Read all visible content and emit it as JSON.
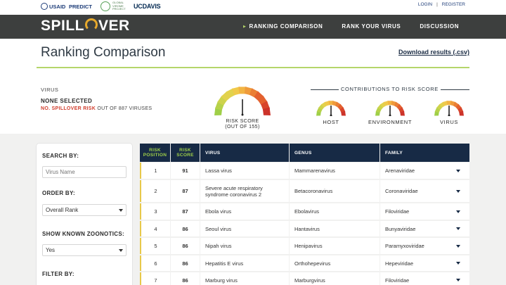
{
  "partners": {
    "usaid": "USAID",
    "predict": "PREDICT",
    "gvp": "GLOBAL VIROME PROJECT",
    "ucdavis": "UCDAVIS"
  },
  "auth": {
    "login": "LOGIN",
    "separator": "|",
    "register": "REGISTER"
  },
  "brand": {
    "name_prefix": "SPILL",
    "name_suffix": "VER"
  },
  "nav": {
    "items": [
      {
        "label": "RANKING COMPARISON",
        "active": true
      },
      {
        "label": "RANK YOUR VIRUS",
        "active": false
      },
      {
        "label": "DISCUSSION",
        "active": false
      }
    ]
  },
  "page": {
    "title": "Ranking Comparison",
    "download_label": "Download results (.csv)"
  },
  "virus_info": {
    "label": "VIRUS",
    "selected": "NONE SELECTED",
    "risk_highlight": "NO. SPILLOVER RISK",
    "risk_rest": "OUT OF 887 VIRUSES"
  },
  "risk_gauge": {
    "label_line1": "RISK SCORE",
    "label_line2": "(OUT OF 155)"
  },
  "contributions": {
    "title": "CONTRIBUTIONS TO RISK SCORE",
    "gauges": [
      {
        "label": "HOST"
      },
      {
        "label": "ENVIRONMENT"
      },
      {
        "label": "VIRUS"
      }
    ]
  },
  "colors": {
    "accent_green": "#b5d66a",
    "nav_bg": "#3d3f3e",
    "table_header": "#172a45",
    "risk_red": "#d13f2f"
  },
  "sidebar": {
    "search_heading": "SEARCH BY:",
    "search_placeholder": "Virus Name",
    "order_heading": "ORDER BY:",
    "order_value": "Overall Rank",
    "zoonotic_heading": "SHOW KNOWN ZOONOTICS:",
    "zoonotic_value": "Yes",
    "filter_heading": "FILTER BY:"
  },
  "table": {
    "headers": {
      "position": "RISK POSITION",
      "score": "RISK SCORE",
      "virus": "VIRUS",
      "genus": "GENUS",
      "family": "FAMILY"
    },
    "rows": [
      {
        "position": "1",
        "score": "91",
        "virus": "Lassa virus",
        "genus": "Mammarenavirus",
        "family": "Arenaviridae"
      },
      {
        "position": "2",
        "score": "87",
        "virus": "Severe acute respiratory syndrome coronavirus 2",
        "genus": "Betacoronavirus",
        "family": "Coronaviridae"
      },
      {
        "position": "3",
        "score": "87",
        "virus": "Ebola virus",
        "genus": "Ebolavirus",
        "family": "Filoviridae"
      },
      {
        "position": "4",
        "score": "86",
        "virus": "Seoul virus",
        "genus": "Hantavirus",
        "family": "Bunyaviridae"
      },
      {
        "position": "5",
        "score": "86",
        "virus": "Nipah virus",
        "genus": "Henipavirus",
        "family": "Paramyxoviridae"
      },
      {
        "position": "6",
        "score": "86",
        "virus": "Hepatitis E virus",
        "genus": "Orthohepevirus",
        "family": "Hepeviridae"
      },
      {
        "position": "7",
        "score": "86",
        "virus": "Marburg virus",
        "genus": "Marburgvirus",
        "family": "Filoviridae"
      }
    ]
  }
}
